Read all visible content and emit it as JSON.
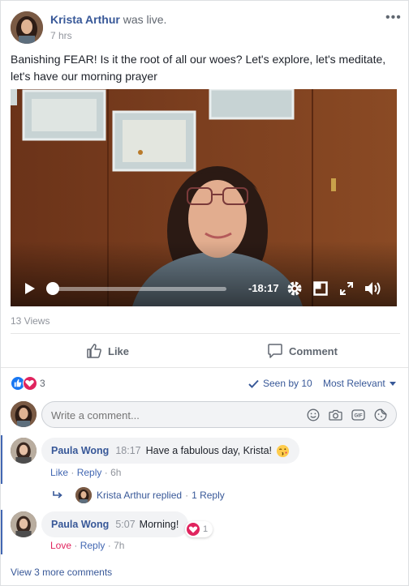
{
  "post": {
    "author": "Krista Arthur",
    "action": "was live.",
    "time": "7 hrs",
    "text": "Banishing FEAR! Is it the root of all our woes? Let's explore, let's meditate, let's have our morning prayer",
    "views": "13 Views"
  },
  "video": {
    "time_remaining": "-18:17",
    "progress": 0
  },
  "actions": {
    "like": "Like",
    "comment": "Comment"
  },
  "reactions": {
    "count": "3",
    "seen_by": "Seen by 10",
    "sort": "Most Relevant"
  },
  "composer": {
    "placeholder": "Write a comment..."
  },
  "comments": [
    {
      "author": "Paula Wong",
      "timestamp": "18:17",
      "text": "Have a fabulous day, Krista!",
      "reaction_label": "Like",
      "reply_label": "Reply",
      "age": "6h"
    },
    {
      "author": "Paula Wong",
      "timestamp": "5:07",
      "text": "Morning!",
      "reaction_label": "Love",
      "reply_label": "Reply",
      "age": "7h",
      "reaction_count": "1"
    }
  ],
  "reply_summary": {
    "author": "Krista Arthur",
    "action": "replied",
    "count": "1 Reply"
  },
  "view_more": "View 3 more comments",
  "colors": {
    "link": "#385898",
    "accent": "#4267b2",
    "love": "#e0245e",
    "like_blue": "#1877f2",
    "text": "#1d2129",
    "muted": "#90949c"
  }
}
